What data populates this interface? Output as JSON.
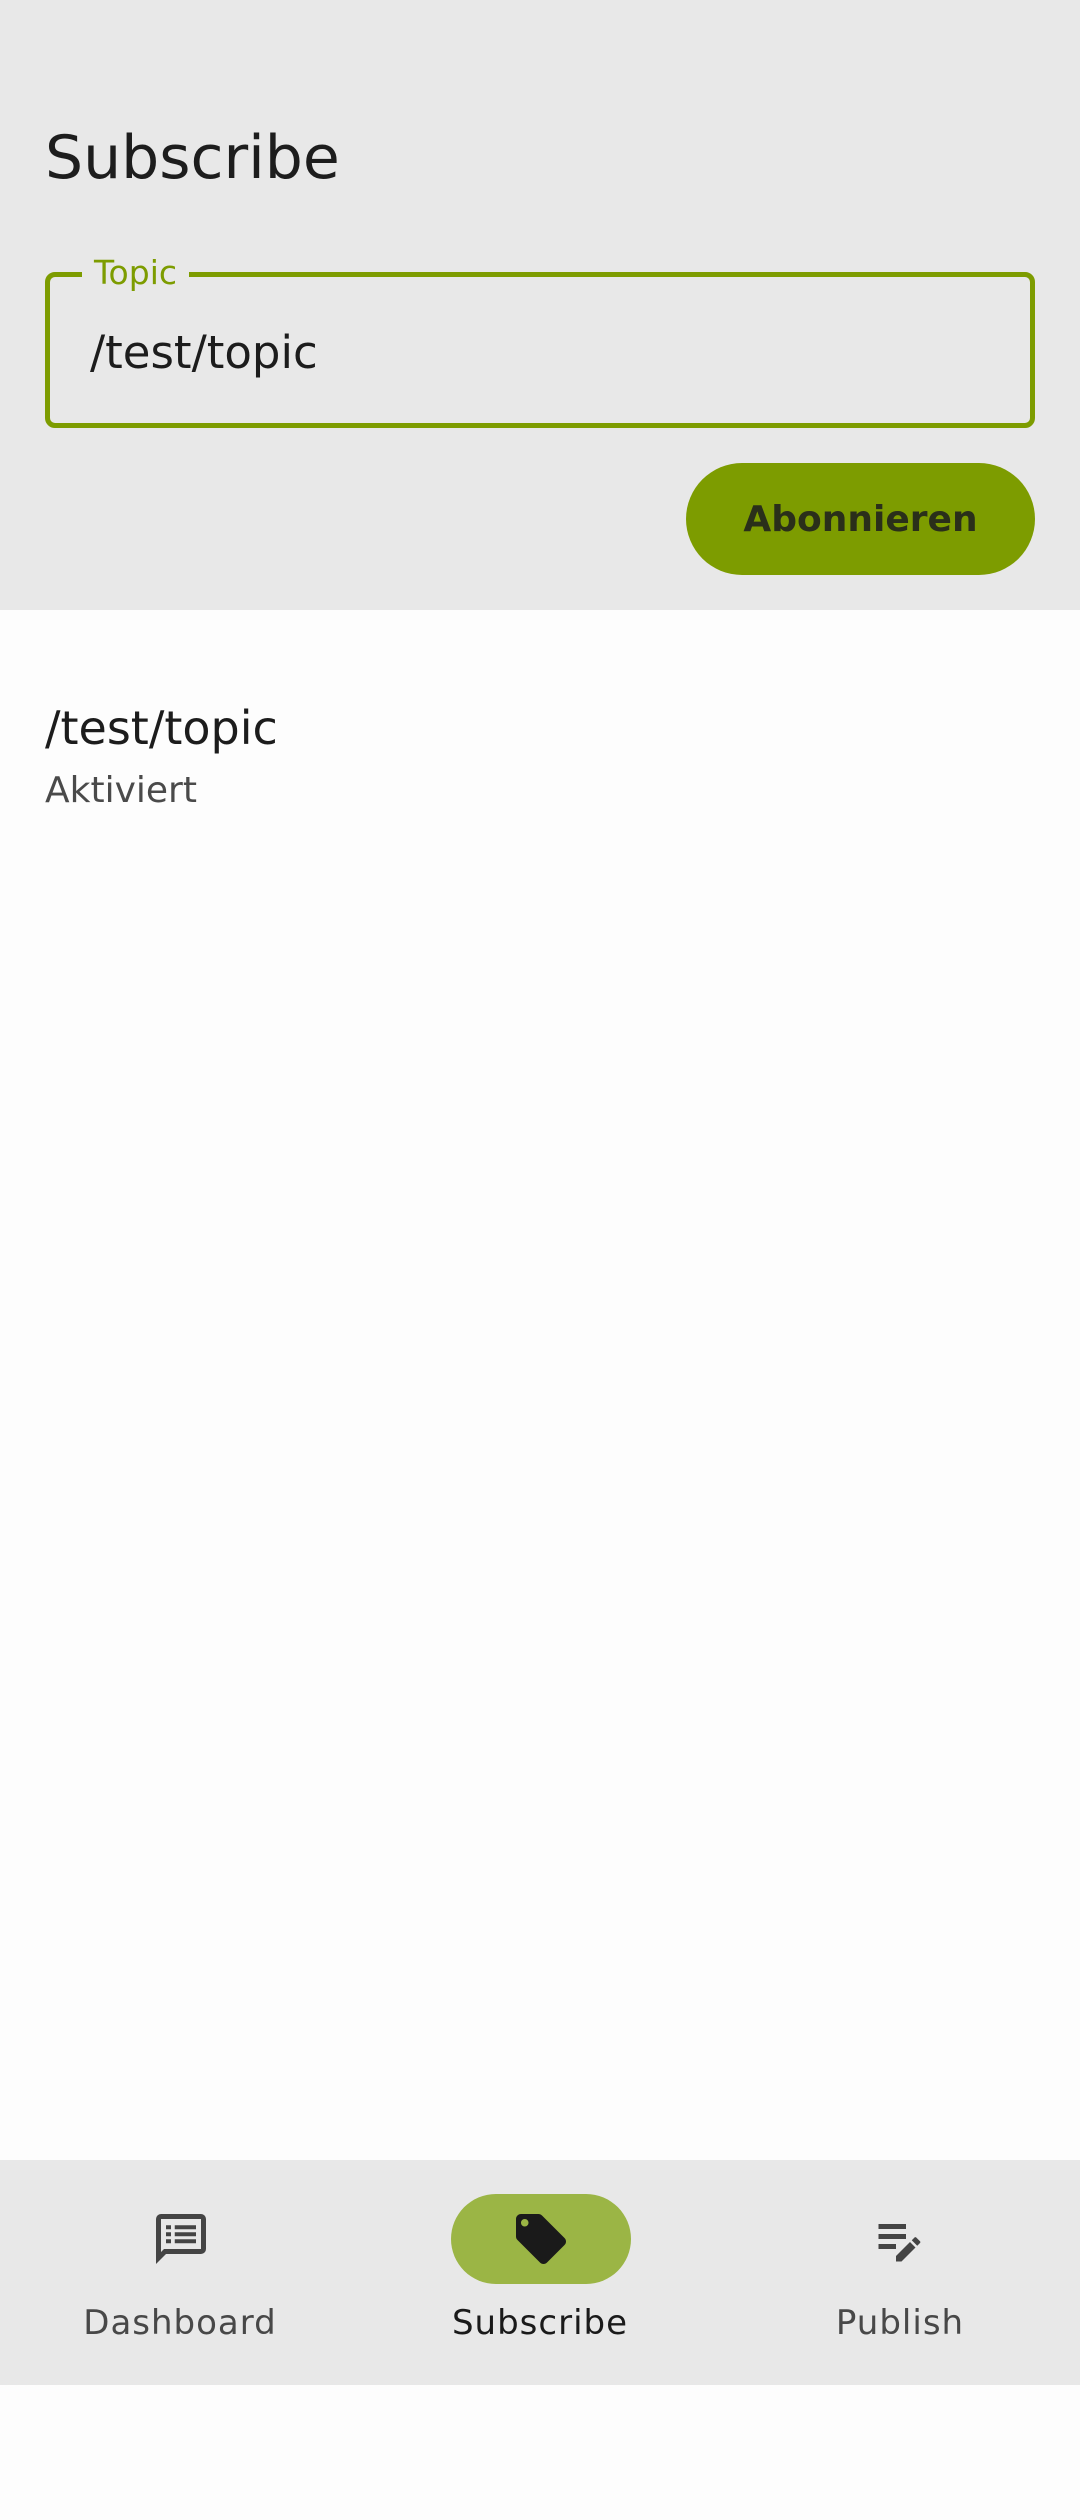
{
  "header": {
    "title": "Subscribe"
  },
  "subscribe_form": {
    "topic_label": "Topic",
    "topic_value": "/test/topic",
    "button_label": "Abonnieren"
  },
  "subscriptions": [
    {
      "topic": "/test/topic",
      "status": "Aktiviert"
    }
  ],
  "bottom_nav": {
    "items": [
      {
        "label": "Dashboard",
        "icon": "message-list-icon",
        "active": false
      },
      {
        "label": "Subscribe",
        "icon": "tag-icon",
        "active": true
      },
      {
        "label": "Publish",
        "icon": "edit-list-icon",
        "active": false
      }
    ]
  },
  "colors": {
    "accent": "#7d9c00",
    "active_pill": "#9bb545",
    "panel_bg": "#e8e8e8",
    "page_bg": "#fdfdfd"
  }
}
